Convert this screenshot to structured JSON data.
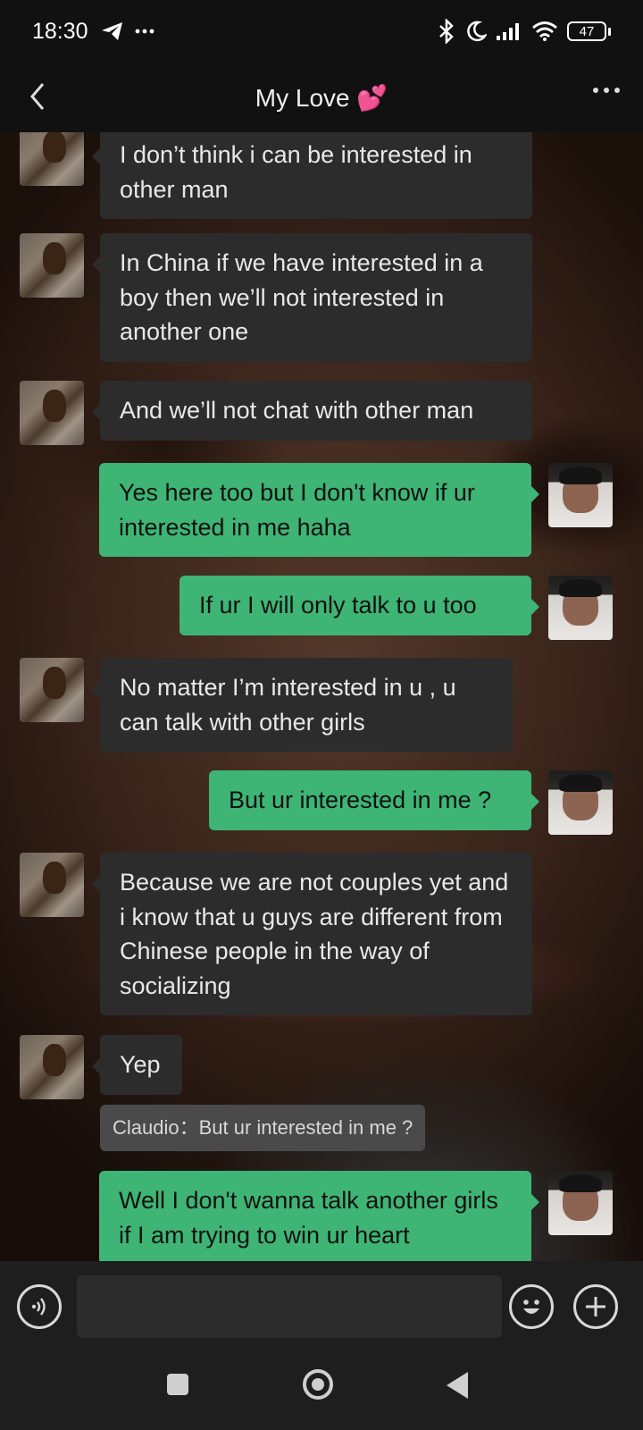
{
  "status_bar": {
    "time": "18:30",
    "battery": "47",
    "icons": [
      "telegram-icon",
      "more-icon",
      "bluetooth-icon",
      "moon-icon",
      "signal-icon",
      "wifi-icon",
      "battery-icon"
    ]
  },
  "header": {
    "title": "My Love 💕"
  },
  "messages": [
    {
      "side": "in",
      "text": "I don’t think i can be interested in other man"
    },
    {
      "side": "in",
      "text": "In China if we have interested in a boy then we’ll not interested in another one"
    },
    {
      "side": "in",
      "text": "And we’ll not chat with other man"
    },
    {
      "side": "out",
      "text": "Yes here too but I don't know if ur interested in me haha"
    },
    {
      "side": "out",
      "text": "If ur I will only talk to u too"
    },
    {
      "side": "in",
      "text": "No matter I’m interested in u , u can talk with other girls"
    },
    {
      "side": "out",
      "text": "But ur interested in me ?"
    },
    {
      "side": "in",
      "text": "Because we are not couples yet and i know that u guys are different from Chinese people in the way of socializing"
    },
    {
      "side": "in",
      "text": "Yep"
    },
    {
      "side": "out",
      "text": "Well I don't wanna talk another girls if I am trying to win ur heart"
    }
  ],
  "quote": "Claudio：But ur interested in me ?",
  "input": {
    "placeholder": "",
    "value": ""
  },
  "colors": {
    "incoming_bubble": "#2c2c2c",
    "outgoing_bubble": "#3eb575",
    "bar_background": "#111111"
  }
}
